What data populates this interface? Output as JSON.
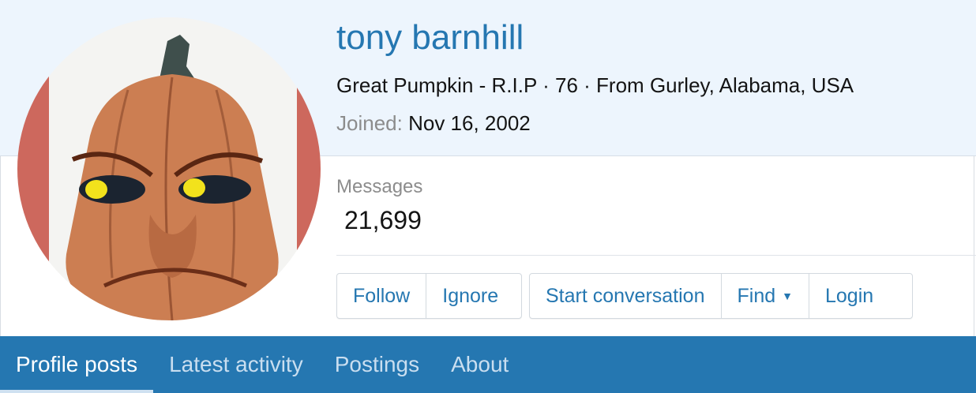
{
  "profile": {
    "name": "tony barnhill",
    "title": "Great Pumpkin - R.I.P",
    "separator": "·",
    "age": "76",
    "location_prefix": "From",
    "location": "Gurley, Alabama, USA",
    "joined_label": "Joined:",
    "joined_date": "Nov 16, 2002"
  },
  "stats": {
    "messages_label": "Messages",
    "messages_value": "21,699"
  },
  "actions": {
    "follow": "Follow",
    "ignore": "Ignore",
    "start_conversation": "Start conversation",
    "find": "Find",
    "login": "Login"
  },
  "tabs": [
    {
      "label": "Profile posts",
      "active": true
    },
    {
      "label": "Latest activity",
      "active": false
    },
    {
      "label": "Postings",
      "active": false
    },
    {
      "label": "About",
      "active": false
    }
  ],
  "colors": {
    "accent": "#2577b1",
    "header_bg": "#edf5fd"
  }
}
